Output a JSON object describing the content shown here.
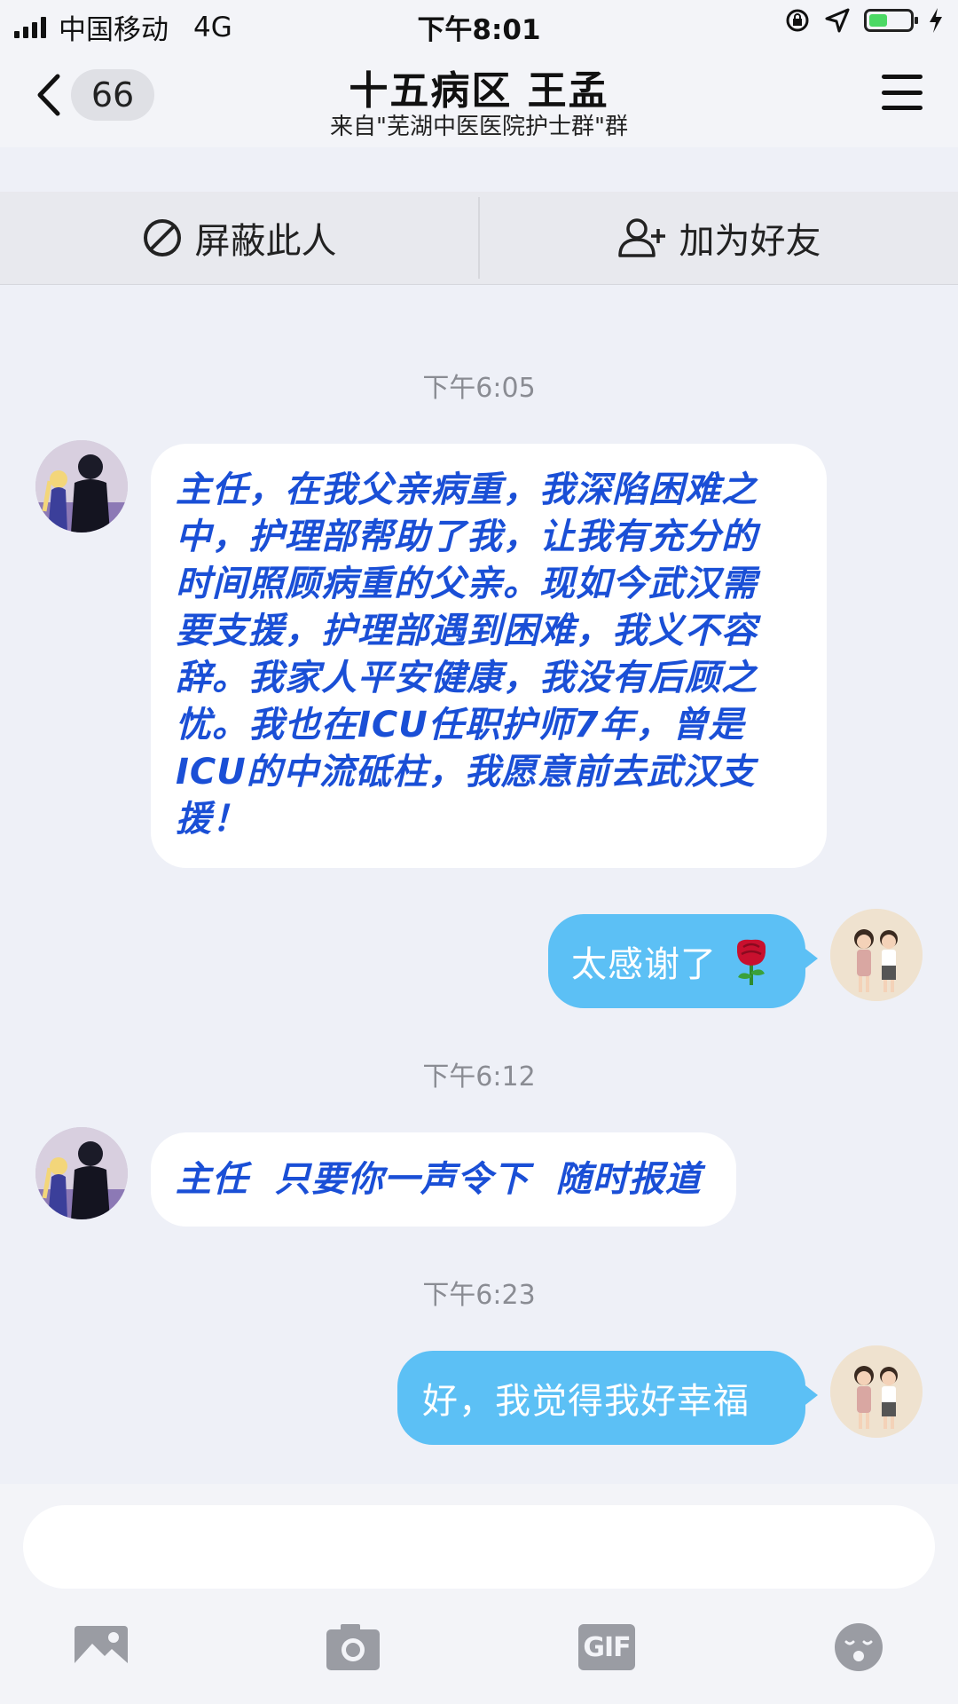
{
  "status_bar": {
    "carrier": "中国移动",
    "network": "4G",
    "time": "下午8:01",
    "battery_level": 0.45
  },
  "nav": {
    "back_count": "66",
    "title": "十五病区 王孟",
    "subtitle": "来自\"芜湖中医医院护士群\"群"
  },
  "actions": {
    "block_label": "屏蔽此人",
    "add_friend_label": "加为好友"
  },
  "messages": [
    {
      "type": "timestamp",
      "text": "下午6:05"
    },
    {
      "type": "incoming",
      "lines": [
        "主任，在我父亲病重，我深陷困难之",
        "中，护理部帮助了我，让我有充分的",
        "时间照顾病重的父亲。现如今武汉需",
        "要支援，护理部遇到困难，我义不容",
        "辞。我家人平安健康，我没有后顾之",
        "忧。我也在ICU任职护师7年，曾是",
        "ICU的中流砥柱，我愿意前去武汉支",
        "援！"
      ]
    },
    {
      "type": "outgoing",
      "text": "太感谢了",
      "emoji": "rose"
    },
    {
      "type": "timestamp",
      "text": "下午6:12"
    },
    {
      "type": "incoming",
      "text": "主任  只要你一声令下  随时报道"
    },
    {
      "type": "timestamp",
      "text": "下午6:23"
    },
    {
      "type": "outgoing",
      "text": "好，我觉得我好幸福"
    }
  ],
  "input": {
    "value": "",
    "placeholder": ""
  },
  "toolbar": {
    "gif_label": "GIF",
    "icons": [
      "image-icon",
      "camera-icon",
      "gif-icon",
      "emoji-icon"
    ]
  },
  "colors": {
    "incoming_text": "#1a4fd6",
    "outgoing_bubble": "#5cc0f5",
    "background": "#eef0f7"
  }
}
